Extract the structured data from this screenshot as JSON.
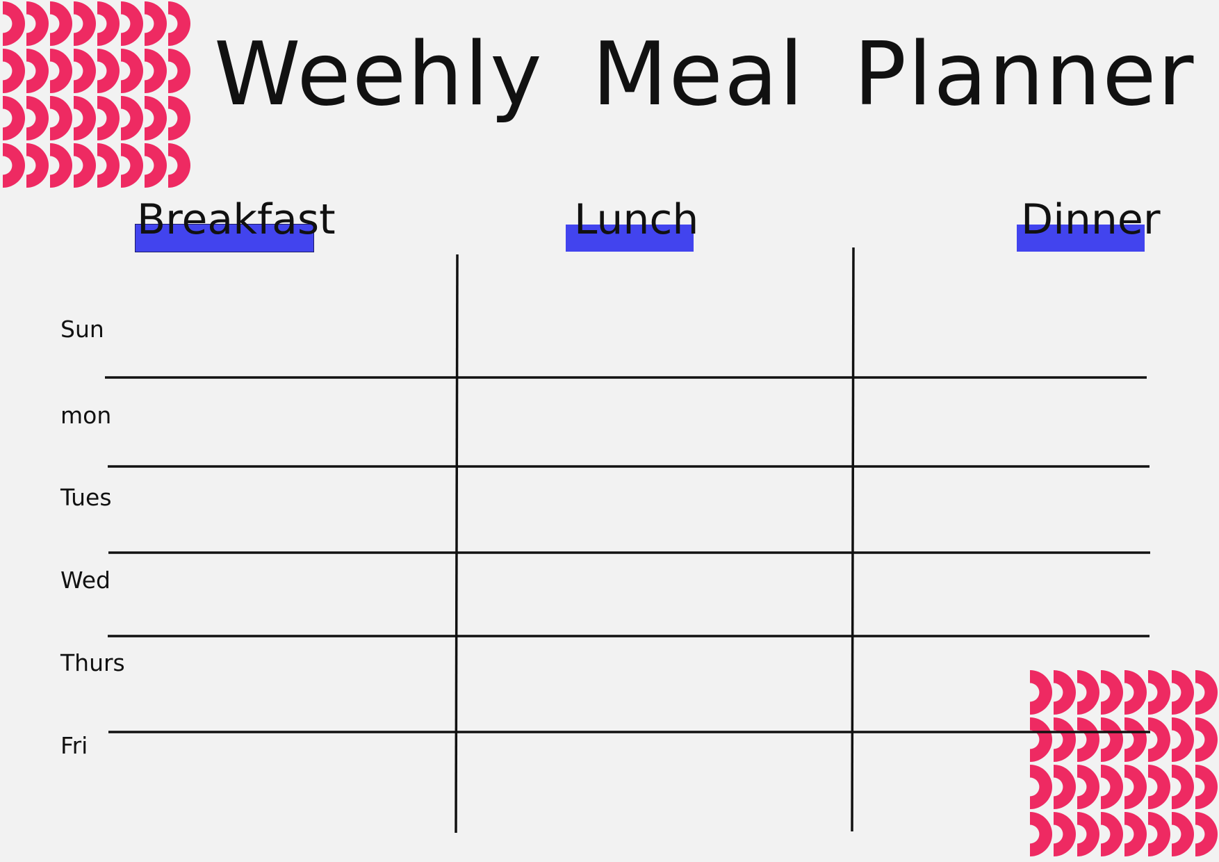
{
  "title": "Weehly Meal Planner",
  "columns": [
    {
      "label": "Breakfast"
    },
    {
      "label": "Lunch"
    },
    {
      "label": "Dinner"
    }
  ],
  "days": [
    {
      "label": "Sun"
    },
    {
      "label": "mon"
    },
    {
      "label": "Tues"
    },
    {
      "label": "Wed"
    },
    {
      "label": "Thurs"
    },
    {
      "label": "Fri"
    }
  ],
  "colors": {
    "background": "#f2f2f2",
    "accent_bar": "#4244ee",
    "pattern": "#ee2a62",
    "ink": "#111111"
  },
  "icons": {
    "decoration": "semicircle-pattern-icon"
  }
}
